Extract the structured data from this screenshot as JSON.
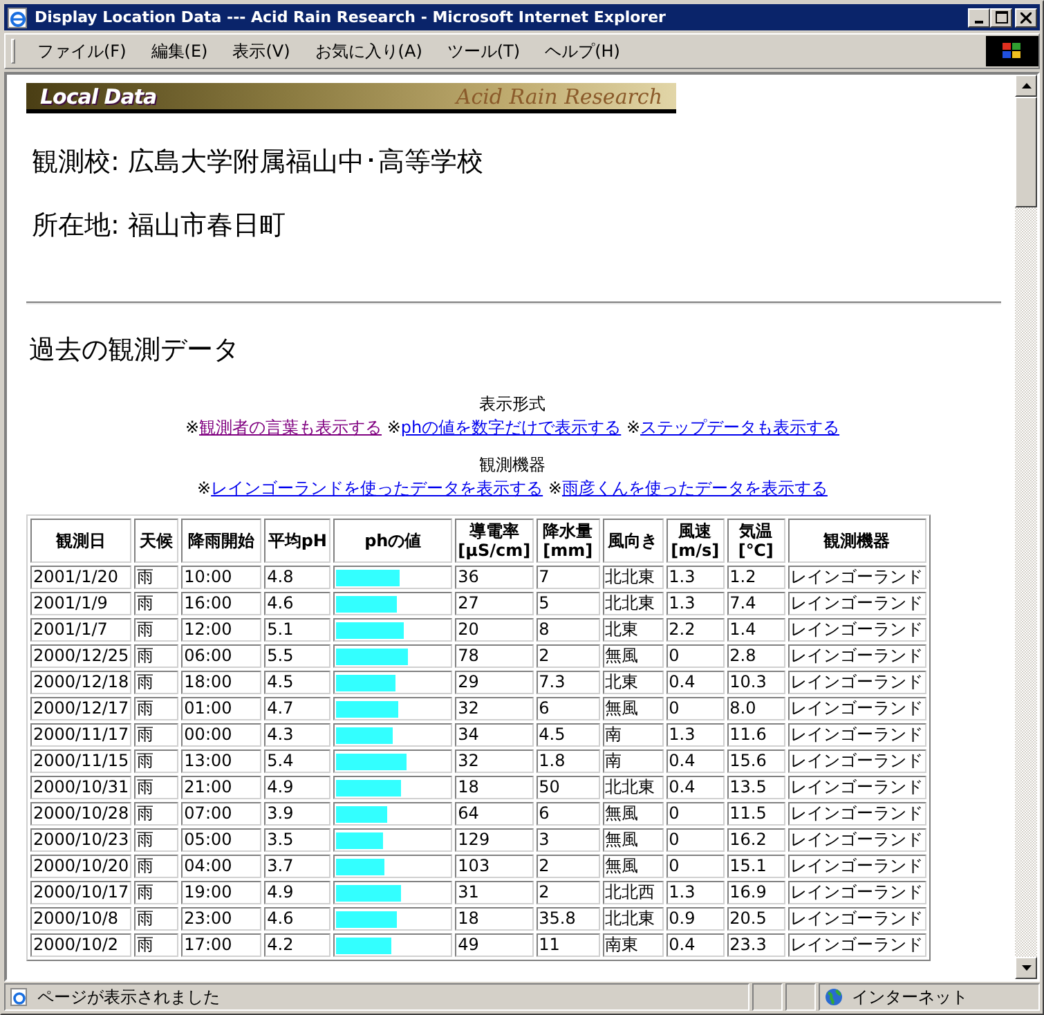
{
  "window": {
    "title": "Display Location Data --- Acid Rain Research - Microsoft Internet Explorer"
  },
  "menu": [
    "ファイル(F)",
    "編集(E)",
    "表示(V)",
    "お気に入り(A)",
    "ツール(T)",
    "ヘルプ(H)"
  ],
  "banner": {
    "title": "Local Data",
    "subtitle": "Acid Rain Research"
  },
  "school": "観測校: 広島大学附属福山中･高等学校",
  "address": "所在地: 福山市春日町",
  "section_heading": "過去の観測データ",
  "link_groups": [
    {
      "heading": "表示形式",
      "links": [
        {
          "mark": "※",
          "text": "観測者の言葉も表示する",
          "visited": true
        },
        {
          "mark": "※",
          "text": "phの値を数字だけで表示する",
          "visited": false
        },
        {
          "mark": "※",
          "text": "ステップデータも表示する",
          "visited": false
        }
      ]
    },
    {
      "heading": "観測機器",
      "links": [
        {
          "mark": "※",
          "text": "レインゴーランドを使ったデータを表示する",
          "visited": false
        },
        {
          "mark": "※",
          "text": "雨彦くんを使ったデータを表示する",
          "visited": false
        }
      ]
    }
  ],
  "table": {
    "columns": [
      "観測日",
      "天候",
      "降雨開始",
      "平均pH",
      "phの値",
      "導電率\n[μS/cm]",
      "降水量\n[mm]",
      "風向き",
      "風速\n[m/s]",
      "気温\n[℃]",
      "観測機器"
    ],
    "rows": [
      {
        "cells": [
          "2001/1/20",
          "雨",
          "10:00",
          "4.8",
          "",
          "36",
          "7",
          "北北東",
          "1.3",
          "1.2",
          "レインゴーランド"
        ],
        "level": 0.57
      },
      {
        "cells": [
          "2001/1/9",
          "雨",
          "16:00",
          "4.6",
          "",
          "27",
          "5",
          "北北東",
          "1.3",
          "7.4",
          "レインゴーランド"
        ],
        "level": 0.55
      },
      {
        "cells": [
          "2001/1/7",
          "雨",
          "12:00",
          "5.1",
          "",
          "20",
          "8",
          "北東",
          "2.2",
          "1.4",
          "レインゴーランド"
        ],
        "level": 0.61
      },
      {
        "cells": [
          "2000/12/25",
          "雨",
          "06:00",
          "5.5",
          "",
          "78",
          "2",
          "無風",
          "0",
          "2.8",
          "レインゴーランド"
        ],
        "level": 0.65
      },
      {
        "cells": [
          "2000/12/18",
          "雨",
          "18:00",
          "4.5",
          "",
          "29",
          "7.3",
          "北東",
          "0.4",
          "10.3",
          "レインゴーランド"
        ],
        "level": 0.54
      },
      {
        "cells": [
          "2000/12/17",
          "雨",
          "01:00",
          "4.7",
          "",
          "32",
          "6",
          "無風",
          "0",
          "8.0",
          "レインゴーランド"
        ],
        "level": 0.56
      },
      {
        "cells": [
          "2000/11/17",
          "雨",
          "00:00",
          "4.3",
          "",
          "34",
          "4.5",
          "南",
          "1.3",
          "11.6",
          "レインゴーランド"
        ],
        "level": 0.51
      },
      {
        "cells": [
          "2000/11/15",
          "雨",
          "13:00",
          "5.4",
          "",
          "32",
          "1.8",
          "南",
          "0.4",
          "15.6",
          "レインゴーランド"
        ],
        "level": 0.64
      },
      {
        "cells": [
          "2000/10/31",
          "雨",
          "21:00",
          "4.9",
          "",
          "18",
          "50",
          "北北東",
          "0.4",
          "13.5",
          "レインゴーランド"
        ],
        "level": 0.58
      },
      {
        "cells": [
          "2000/10/28",
          "雨",
          "07:00",
          "3.9",
          "",
          "64",
          "6",
          "無風",
          "0",
          "11.5",
          "レインゴーランド"
        ],
        "level": 0.46
      },
      {
        "cells": [
          "2000/10/23",
          "雨",
          "05:00",
          "3.5",
          "",
          "129",
          "3",
          "無風",
          "0",
          "16.2",
          "レインゴーランド"
        ],
        "level": 0.42
      },
      {
        "cells": [
          "2000/10/20",
          "雨",
          "04:00",
          "3.7",
          "",
          "103",
          "2",
          "無風",
          "0",
          "15.1",
          "レインゴーランド"
        ],
        "level": 0.44
      },
      {
        "cells": [
          "2000/10/17",
          "雨",
          "19:00",
          "4.9",
          "",
          "31",
          "2",
          "北北西",
          "1.3",
          "16.9",
          "レインゴーランド"
        ],
        "level": 0.58
      },
      {
        "cells": [
          "2000/10/8",
          "雨",
          "23:00",
          "4.6",
          "",
          "18",
          "35.8",
          "北北東",
          "0.9",
          "20.5",
          "レインゴーランド"
        ],
        "level": 0.55
      },
      {
        "cells": [
          "2000/10/2",
          "雨",
          "17:00",
          "4.2",
          "",
          "49",
          "11",
          "南東",
          "0.4",
          "23.3",
          "レインゴーランド"
        ],
        "level": 0.5
      }
    ]
  },
  "status_bar": {
    "message": "ページが表示されました",
    "zone": "インターネット"
  }
}
